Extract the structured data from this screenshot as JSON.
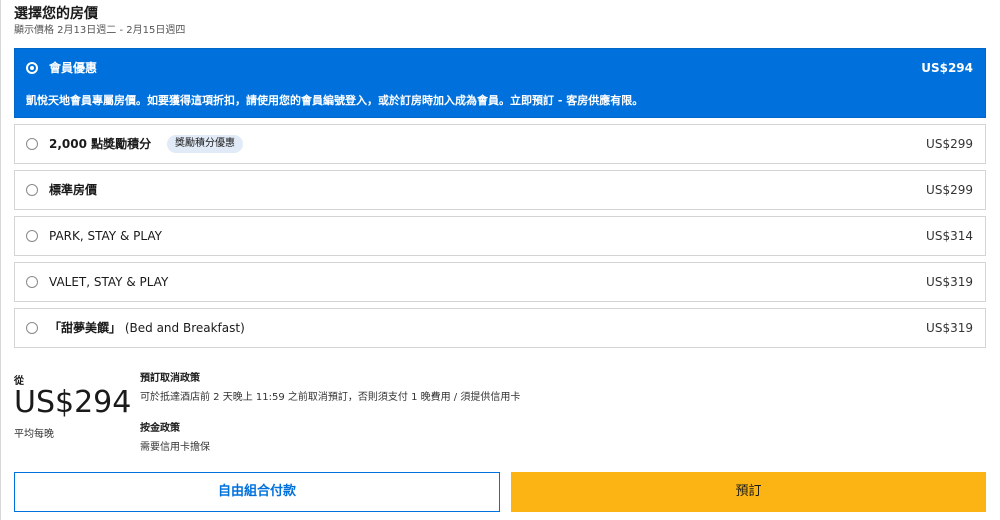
{
  "header": {
    "title": "選擇您的房價",
    "date_range": "顯示價格 2月13日週二 - 2月15日週四"
  },
  "rates": [
    {
      "name": "會員優惠",
      "price": "US$294",
      "description": "凱悅天地會員專屬房價。如要獲得這項折扣，請使用您的會員編號登入，或於訂房時加入成為會員。立即預訂 - 客房供應有限。",
      "selected": true
    },
    {
      "name": "2,000 點獎勵積分",
      "price": "US$299",
      "tag": "獎勵積分優惠"
    },
    {
      "name": "標準房價",
      "price": "US$299"
    },
    {
      "name": "PARK, STAY & PLAY",
      "price": "US$314"
    },
    {
      "name": "VALET, STAY & PLAY",
      "price": "US$319"
    },
    {
      "name_prefix": "「甜夢美饌」",
      "name_suffix": "(Bed and Breakfast)",
      "price": "US$319"
    }
  ],
  "summary": {
    "from_label": "從",
    "price": "US$294",
    "per_night": "平均每晚",
    "cancellation": {
      "title": "預訂取消政策",
      "text": "可於抵達酒店前 2 天晚上 11:59 之前取消預訂，否則須支付 1 晚費用 / 須提供信用卡"
    },
    "deposit": {
      "title": "按金政策",
      "text": "需要信用卡擔保"
    }
  },
  "actions": {
    "pay_label": "自由組合付款",
    "book_label": "預訂"
  },
  "colors": {
    "accent": "#0071dc",
    "book_button": "#fbb413",
    "tag_bg": "#e1ebf7"
  }
}
